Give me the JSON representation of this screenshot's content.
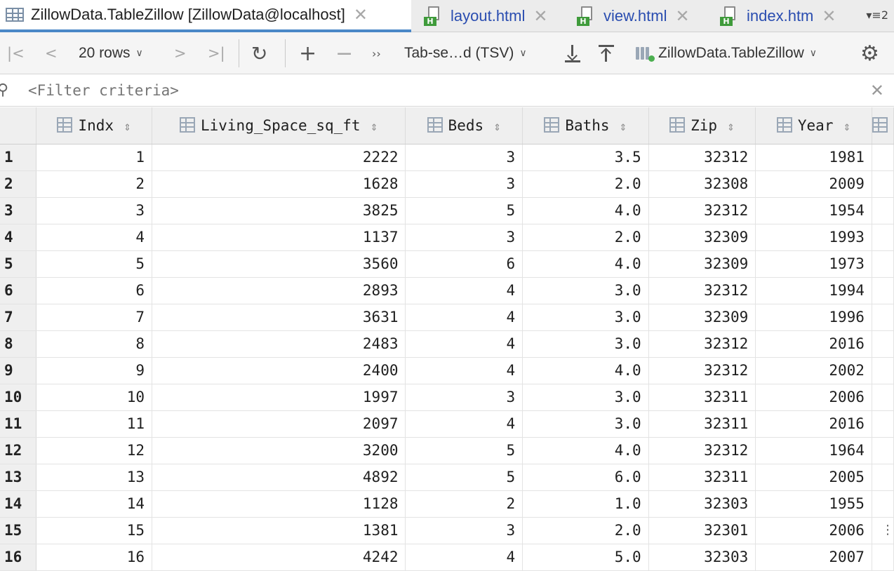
{
  "tabs": [
    {
      "label": "ZillowData.TableZillow [ZillowData@localhost]",
      "icon": "table-icon",
      "active": true
    },
    {
      "label": "layout.html",
      "icon": "html-file-icon",
      "active": false
    },
    {
      "label": "view.html",
      "icon": "html-file-icon",
      "active": false
    },
    {
      "label": "index.htm",
      "icon": "html-file-icon",
      "active": false
    }
  ],
  "tab_overflow_count": "2",
  "toolbar": {
    "rows_label": "20 rows",
    "export_format": "Tab-se…d (TSV)",
    "datasource": "ZillowData.TableZillow"
  },
  "filter": {
    "placeholder": "<Filter criteria>"
  },
  "grid": {
    "columns": [
      "Indx",
      "Living_Space_sq_ft",
      "Beds",
      "Baths",
      "Zip",
      "Year"
    ],
    "rows": [
      [
        "1",
        "1",
        "2222",
        "3",
        "3.5",
        "32312",
        "1981"
      ],
      [
        "2",
        "2",
        "1628",
        "3",
        "2.0",
        "32308",
        "2009"
      ],
      [
        "3",
        "3",
        "3825",
        "5",
        "4.0",
        "32312",
        "1954"
      ],
      [
        "4",
        "4",
        "1137",
        "3",
        "2.0",
        "32309",
        "1993"
      ],
      [
        "5",
        "5",
        "3560",
        "6",
        "4.0",
        "32309",
        "1973"
      ],
      [
        "6",
        "6",
        "2893",
        "4",
        "3.0",
        "32312",
        "1994"
      ],
      [
        "7",
        "7",
        "3631",
        "4",
        "3.0",
        "32309",
        "1996"
      ],
      [
        "8",
        "8",
        "2483",
        "4",
        "3.0",
        "32312",
        "2016"
      ],
      [
        "9",
        "9",
        "2400",
        "4",
        "4.0",
        "32312",
        "2002"
      ],
      [
        "10",
        "10",
        "1997",
        "3",
        "3.0",
        "32311",
        "2006"
      ],
      [
        "11",
        "11",
        "2097",
        "4",
        "3.0",
        "32311",
        "2016"
      ],
      [
        "12",
        "12",
        "3200",
        "5",
        "4.0",
        "32312",
        "1964"
      ],
      [
        "13",
        "13",
        "4892",
        "5",
        "6.0",
        "32311",
        "2005"
      ],
      [
        "14",
        "14",
        "1128",
        "2",
        "1.0",
        "32303",
        "1955"
      ],
      [
        "15",
        "15",
        "1381",
        "3",
        "2.0",
        "32301",
        "2006"
      ],
      [
        "16",
        "16",
        "4242",
        "4",
        "5.0",
        "32303",
        "2007"
      ]
    ]
  },
  "colors": {
    "active_tab_underline": "#4a88c7",
    "link_tab_text": "#2a4db0",
    "html_badge": "#3f9b3b",
    "connected_dot": "#4caf50"
  }
}
